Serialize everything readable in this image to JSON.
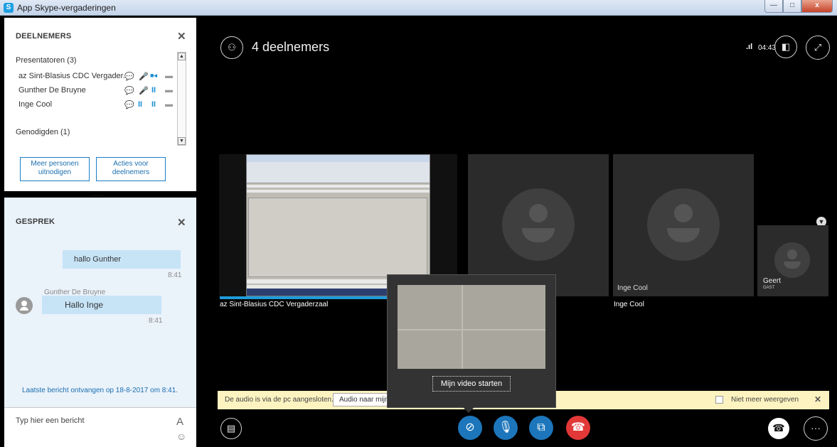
{
  "window": {
    "title": "App Skype-vergaderingen",
    "logo": "S",
    "min": "—",
    "max": "□",
    "close": "x"
  },
  "participants": {
    "heading": "DEELNEMERS",
    "close": "✕",
    "presenters_label": "Presentatoren (3)",
    "presenters": [
      {
        "name": "az Sint-Blasius CDC Vergader...",
        "icons": [
          "chat-icon",
          "mic-icon",
          "video-icon",
          "screen-icon"
        ]
      },
      {
        "name": "Gunther De Bruyne",
        "icons": [
          "chat-icon",
          "mic-icon",
          "pause-icon",
          "screen-icon"
        ]
      },
      {
        "name": "Inge Cool",
        "icons": [
          "chat-icon",
          "pause-icon",
          "pause-icon",
          "screen-icon"
        ]
      }
    ],
    "invitees_label": "Genodigden (1)",
    "invite_button": "Meer personen uitnodigen",
    "actions_button": "Acties voor deelnemers"
  },
  "chat": {
    "heading": "GESPREK",
    "close": "✕",
    "messages": [
      {
        "text": "hallo Gunther",
        "time": "8:41"
      },
      {
        "sender": "Gunther De Bruyne",
        "text": "Hallo Inge",
        "time": "8:41"
      }
    ],
    "last_received": "Laatste bericht ontvangen op 18-8-2017 om 8:41.",
    "input_placeholder": "Typ hier een bericht",
    "font_icon": "A",
    "emoji_icon": "☺"
  },
  "stage": {
    "count_label": "4 deelnemers",
    "signal": ".ıl",
    "time": "04:43",
    "tiles": [
      {
        "label": "az Sint-Blasius CDC Vergaderzaal"
      },
      {
        "label": "Inge Cool"
      },
      {
        "label": "Geert",
        "badge": "GAST"
      }
    ],
    "bottom_label_right": "Inge Cool",
    "video_popup_button": "Mijn video starten",
    "banner": {
      "text": "De audio is via de pc aangesloten.",
      "button": "Audio naar mijn",
      "dont_show": "Niet meer weergeven",
      "close": "✕"
    }
  }
}
